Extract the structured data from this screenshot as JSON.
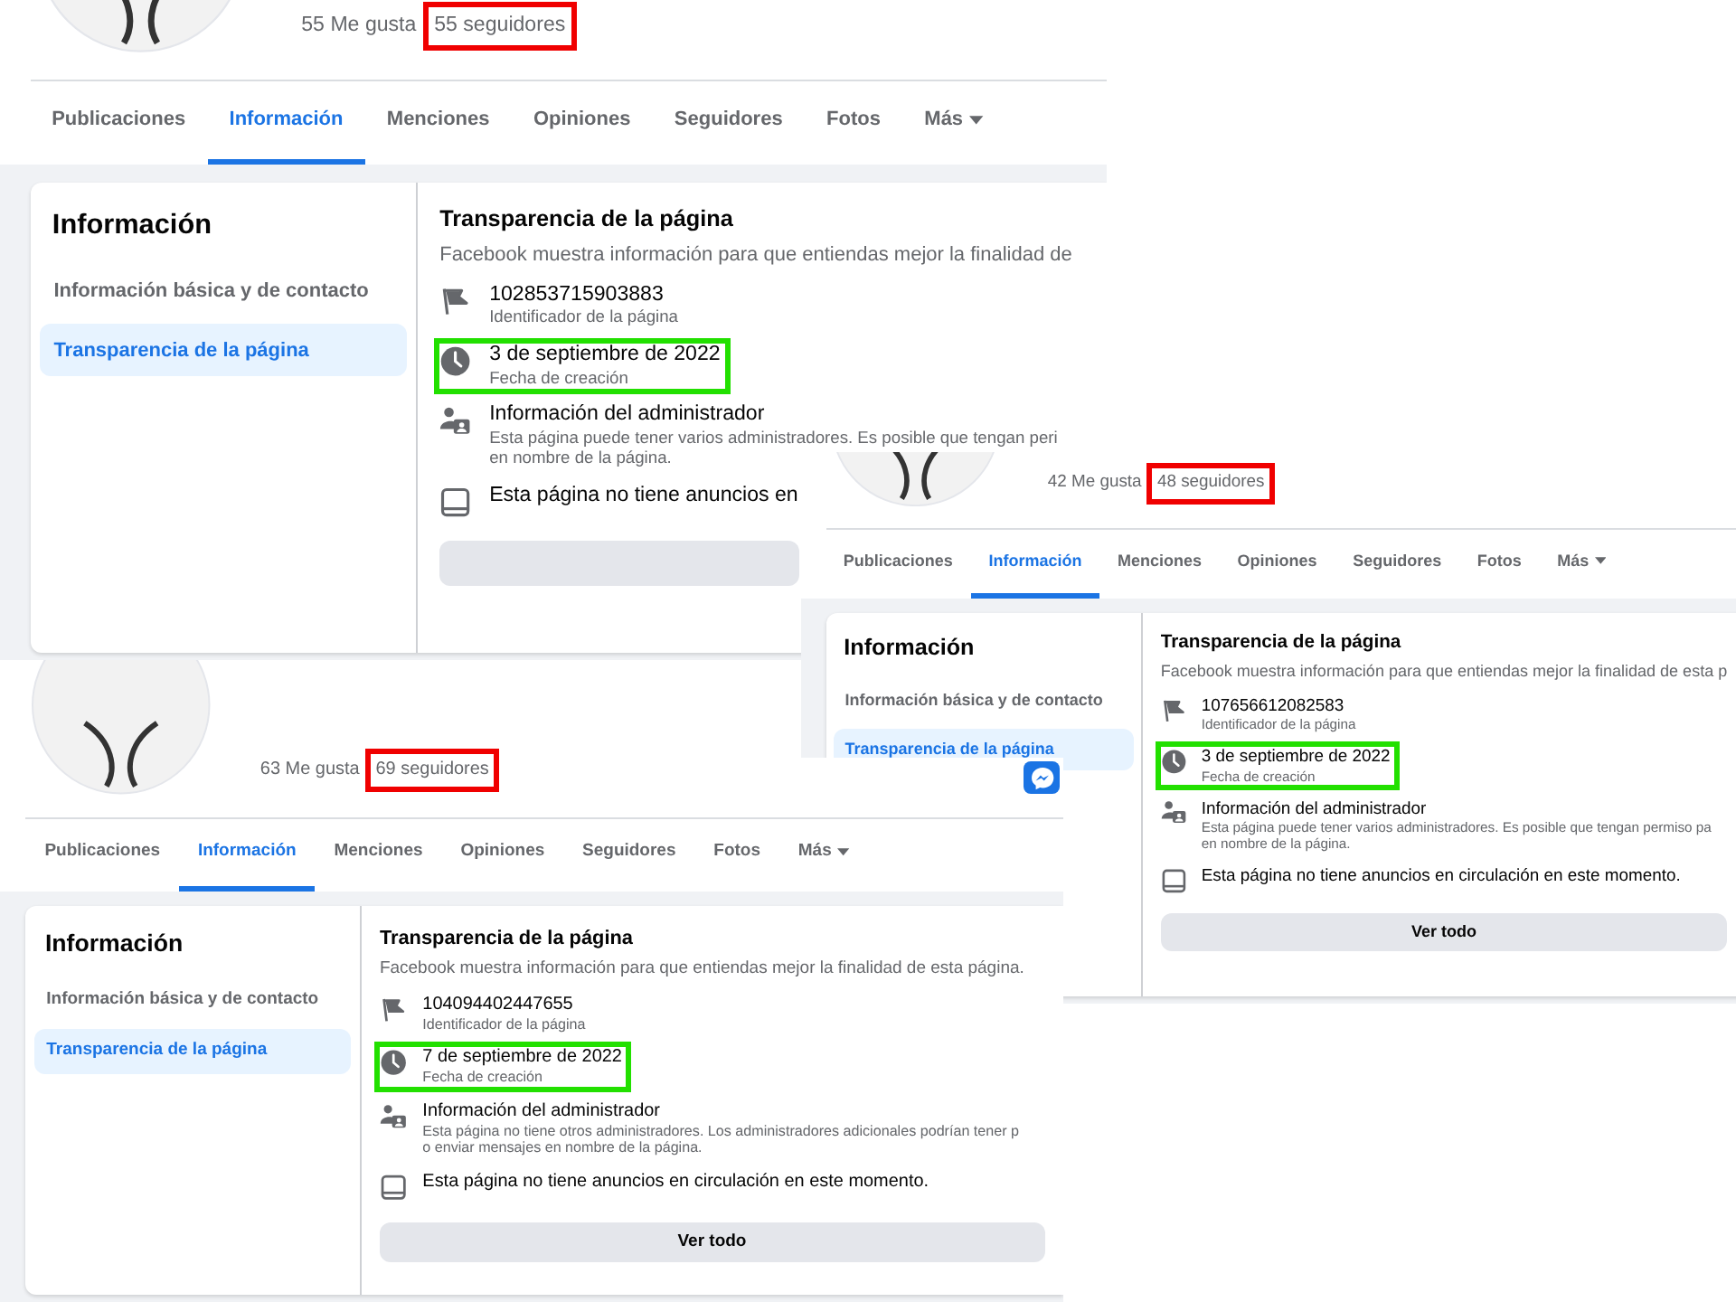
{
  "screenshots": [
    {
      "likes": "55 Me gusta",
      "followers": {
        "text": "55 seguidores",
        "highlighted": true
      },
      "tabs": [
        {
          "label": "Publicaciones",
          "selected": false
        },
        {
          "label": "Información",
          "selected": true
        },
        {
          "label": "Menciones",
          "selected": false
        },
        {
          "label": "Opiniones",
          "selected": false
        },
        {
          "label": "Seguidores",
          "selected": false
        },
        {
          "label": "Fotos",
          "selected": false
        },
        {
          "label": "Más",
          "selected": false,
          "dropdown": true
        }
      ],
      "sidebar": {
        "title": "Información",
        "items": [
          {
            "label": "Información básica y de contacto",
            "selected": false
          },
          {
            "label": "Transparencia de la página",
            "selected": true
          }
        ]
      },
      "section": {
        "title": "Transparencia de la página",
        "description": "Facebook muestra información para que entiendas mejor la finalidad de",
        "rows": [
          {
            "kind": "flag",
            "title": "102853715903883",
            "details": [
              "Identificador de la página"
            ],
            "highlighted": false
          },
          {
            "kind": "clock",
            "title": "3 de septiembre de 2022",
            "details": [
              "Fecha de creación"
            ],
            "highlighted": true
          },
          {
            "kind": "admin",
            "title": "Información del administrador",
            "details": [
              "Esta página puede tener varios administradores. Es posible que tengan peri",
              "en nombre de la página."
            ],
            "highlighted": false
          },
          {
            "kind": "ads",
            "title": "Esta página no tiene anuncios en",
            "highlighted": false
          }
        ]
      }
    },
    {
      "likes": "42 Me gusta",
      "followers": {
        "text": "48 seguidores",
        "highlighted": true
      },
      "tabs": [
        {
          "label": "Publicaciones",
          "selected": false
        },
        {
          "label": "Información",
          "selected": true
        },
        {
          "label": "Menciones",
          "selected": false
        },
        {
          "label": "Opiniones",
          "selected": false
        },
        {
          "label": "Seguidores",
          "selected": false
        },
        {
          "label": "Fotos",
          "selected": false
        },
        {
          "label": "Más",
          "selected": false,
          "dropdown": true
        }
      ],
      "sidebar": {
        "title": "Información",
        "items": [
          {
            "label": "Información básica y de contacto",
            "selected": false
          },
          {
            "label": "Transparencia de la página",
            "selected": true
          }
        ]
      },
      "section": {
        "title": "Transparencia de la página",
        "description": "Facebook muestra información para que entiendas mejor la finalidad de esta p",
        "rows": [
          {
            "kind": "flag",
            "title": "107656612082583",
            "details": [
              "Identificador de la página"
            ],
            "highlighted": false
          },
          {
            "kind": "clock",
            "title": "3 de septiembre de 2022",
            "details": [
              "Fecha de creación"
            ],
            "highlighted": true
          },
          {
            "kind": "admin",
            "title": "Información del administrador",
            "details": [
              "Esta página puede tener varios administradores. Es posible que tengan permiso pa",
              "en nombre de la página."
            ],
            "highlighted": false
          },
          {
            "kind": "ads",
            "title": "Esta página no tiene anuncios en circulación en este momento.",
            "highlighted": false
          }
        ],
        "button": "Ver todo"
      }
    },
    {
      "likes": "63 Me gusta",
      "followers": {
        "text": "69 seguidores",
        "highlighted": true
      },
      "tabs": [
        {
          "label": "Publicaciones",
          "selected": false
        },
        {
          "label": "Información",
          "selected": true
        },
        {
          "label": "Menciones",
          "selected": false
        },
        {
          "label": "Opiniones",
          "selected": false
        },
        {
          "label": "Seguidores",
          "selected": false
        },
        {
          "label": "Fotos",
          "selected": false
        },
        {
          "label": "Más",
          "selected": false,
          "dropdown": true
        }
      ],
      "sidebar": {
        "title": "Información",
        "items": [
          {
            "label": "Información básica y de contacto",
            "selected": false
          },
          {
            "label": "Transparencia de la página",
            "selected": true
          }
        ]
      },
      "section": {
        "title": "Transparencia de la página",
        "description": "Facebook muestra información para que entiendas mejor la finalidad de esta página.",
        "rows": [
          {
            "kind": "flag",
            "title": "104094402447655",
            "details": [
              "Identificador de la página"
            ],
            "highlighted": false
          },
          {
            "kind": "clock",
            "title": "7 de septiembre de 2022",
            "details": [
              "Fecha de creación"
            ],
            "highlighted": true
          },
          {
            "kind": "admin",
            "title": "Información del administrador",
            "details": [
              "Esta página no tiene otros administradores. Los administradores adicionales podrían tener p",
              "o enviar mensajes en nombre de la página."
            ],
            "highlighted": false
          },
          {
            "kind": "ads",
            "title": "Esta página no tiene anuncios en circulación en este momento.",
            "highlighted": false
          }
        ],
        "button": "Ver todo"
      }
    }
  ]
}
